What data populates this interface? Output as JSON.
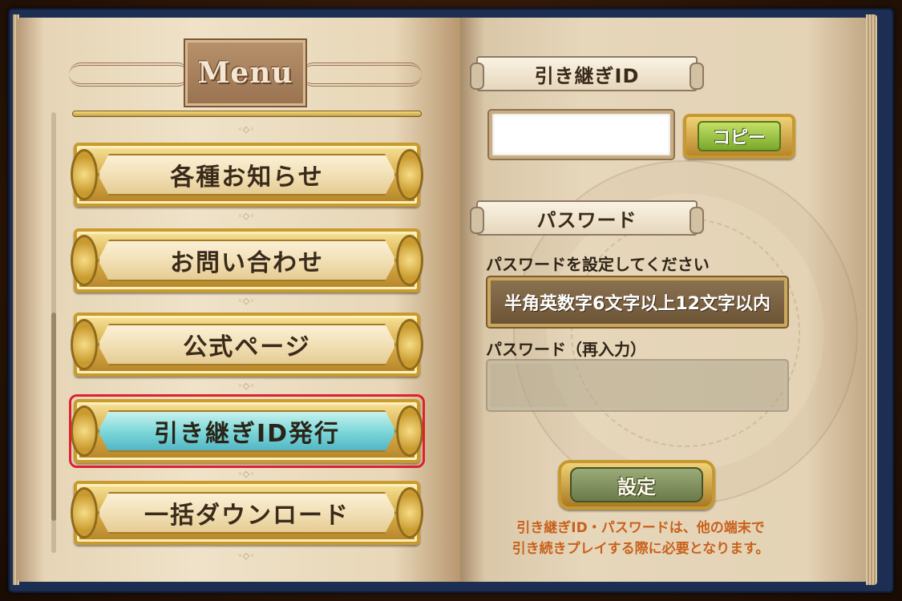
{
  "menu": {
    "title": "Menu",
    "items": [
      {
        "label": "各種お知らせ",
        "active": false
      },
      {
        "label": "お問い合わせ",
        "active": false
      },
      {
        "label": "公式ページ",
        "active": false
      },
      {
        "label": "引き継ぎID発行",
        "active": true
      },
      {
        "label": "一括ダウンロード",
        "active": false
      }
    ]
  },
  "transfer": {
    "id_heading": "引き継ぎID",
    "id_value": "",
    "copy_label": "コピー",
    "password_heading": "パスワード",
    "password_label": "パスワードを設定してください",
    "password_placeholder": "半角英数字6文字以上12文字以内",
    "password_confirm_label": "パスワード（再入力）",
    "password_confirm_value": "",
    "set_label": "設定",
    "notice_line1": "引き継ぎID・パスワードは、他の端末で",
    "notice_line2": "引き続きプレイする際に必要となります。"
  },
  "colors": {
    "active_button": "#7fd8da",
    "highlight": "#e0202c",
    "notice_text": "#c8621c"
  }
}
